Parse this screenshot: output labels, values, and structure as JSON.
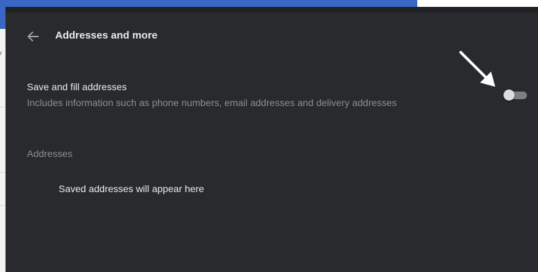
{
  "header": {
    "title": "Addresses and more",
    "back_icon": "arrow-left-icon"
  },
  "setting": {
    "title": "Save and fill addresses",
    "description": "Includes information such as phone numbers, email addresses and delivery addresses",
    "toggle_enabled": false
  },
  "addresses": {
    "section_label": "Addresses",
    "empty_message": "Saved addresses will appear here"
  },
  "colors": {
    "panel_bg": "#292a2d",
    "primary_text": "#e8eaed",
    "secondary_text": "#8b8e93",
    "toggle_track": "#7d7f84",
    "toggle_knob": "#dadce0"
  }
}
